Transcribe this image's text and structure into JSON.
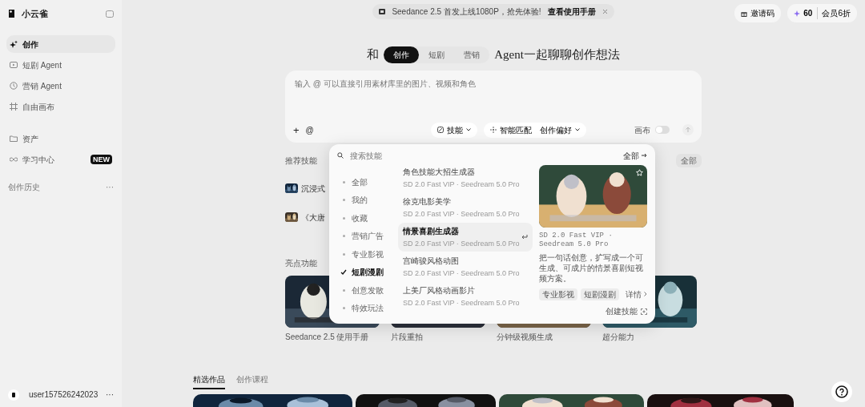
{
  "sidebar": {
    "logo": "小云雀",
    "nav": [
      {
        "label": "创作",
        "selected": true
      },
      {
        "label": "短剧 Agent",
        "selected": false
      },
      {
        "label": "营销 Agent",
        "selected": false
      },
      {
        "label": "自由画布",
        "selected": false
      }
    ],
    "nav2": [
      {
        "label": "资产",
        "selected": false
      },
      {
        "label": "学习中心",
        "badge": "NEW",
        "selected": false
      }
    ],
    "history_title": "创作历史",
    "history_more": "···",
    "user": {
      "name": "user157526242023",
      "more": "···"
    }
  },
  "banner": {
    "text": "Seedance 2.5 首发上线1080P，抢先体验!",
    "link": "查看使用手册"
  },
  "top_buttons": {
    "invite": "邀请码",
    "credits": "60",
    "member": "会员6折"
  },
  "heading": {
    "prefix": "和",
    "modes": [
      {
        "label": "创作",
        "selected": true
      },
      {
        "label": "短剧",
        "selected": false
      },
      {
        "label": "营销",
        "selected": false
      }
    ],
    "suffix": "Agent一起聊聊创作想法"
  },
  "composer": {
    "placeholder": "输入 @ 可以直接引用素材库里的图片、视频和角色",
    "plus": "+",
    "at": "@",
    "skill_button": "技能",
    "smart_match": "智能匹配",
    "preference": "创作偏好",
    "canvas_label": "画布",
    "canvas_on": false
  },
  "recommended": {
    "title": "推荐技能",
    "all": "全部",
    "items": [
      {
        "name": "沉浸式"
      },
      {
        "name": "《大唐"
      }
    ]
  },
  "highlights": {
    "title": "亮点功能",
    "items": [
      {
        "label": "Seedance 2.5 使用手册"
      },
      {
        "label": "片段重拍"
      },
      {
        "label": "分钟级视频生成"
      },
      {
        "label": "超分能力"
      }
    ]
  },
  "gallery_tabs": [
    {
      "label": "精选作品",
      "selected": true
    },
    {
      "label": "创作课程",
      "selected": false
    }
  ],
  "skill_popup": {
    "search_placeholder": "搜索技能",
    "all_link": "全部",
    "categories": [
      {
        "label": "全部",
        "selected": false
      },
      {
        "label": "我的",
        "selected": false
      },
      {
        "label": "收藏",
        "selected": false
      },
      {
        "label": "营销广告",
        "selected": false
      },
      {
        "label": "专业影视",
        "selected": false
      },
      {
        "label": "短剧漫剧",
        "selected": true
      },
      {
        "label": "创意发散",
        "selected": false
      },
      {
        "label": "特效玩法",
        "selected": false
      }
    ],
    "skills": [
      {
        "name": "角色技能大招生成器",
        "models": "SD 2.0 Fast VIP · Seedream 5.0 Pro",
        "selected": false
      },
      {
        "name": "徐克电影美学",
        "models": "SD 2.0 Fast VIP · Seedream 5.0 Pro",
        "selected": false
      },
      {
        "name": "情景喜剧生成器",
        "models": "SD 2.0 Fast VIP · Seedream 5.0 Pro",
        "selected": true
      },
      {
        "name": "宫崎骏风格动图",
        "models": "SD 2.0 Fast VIP · Seedream 5.0 Pro",
        "selected": false
      },
      {
        "name": "上美厂风格动画影片",
        "models": "SD 2.0 Fast VIP · Seedream 5.0 Pro",
        "selected": false
      }
    ],
    "preview": {
      "models": "SD 2.0 Fast VIP · Seedream 5.0 Pro",
      "description": "把一句话创意，扩写成一个可生成、可成片的情景喜剧短视频方案。",
      "tags": [
        "专业影视",
        "短剧漫剧"
      ],
      "details": "详情",
      "favorite": false
    },
    "create": "创建技能"
  }
}
